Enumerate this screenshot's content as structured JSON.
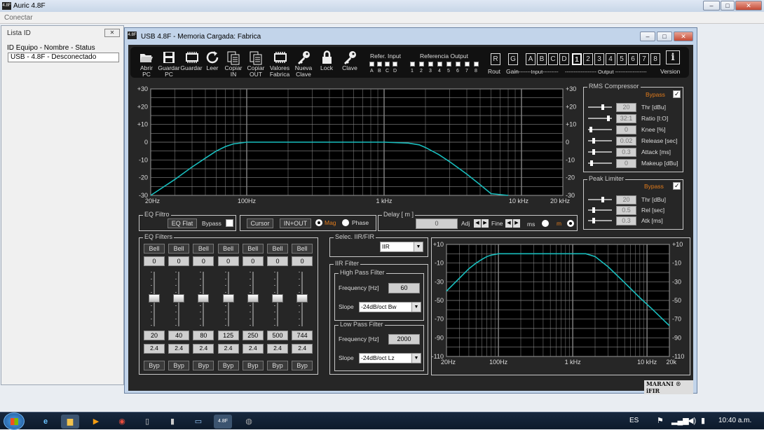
{
  "app": {
    "title": "Auric 4.8F",
    "menu_conectar": "Conectar"
  },
  "lista": {
    "title": "Lista ID",
    "header": "ID Equipo - Nombre - Status",
    "items": [
      "USB - 4.8F - Desconectado"
    ]
  },
  "main_window": {
    "title": "USB  4.8F  -  Memoria Cargada: Fabrica"
  },
  "toolbar": [
    {
      "line1": "Abrir",
      "line2": "PC",
      "icon": "folder-open-icon"
    },
    {
      "line1": "Guardar",
      "line2": "PC",
      "icon": "save-icon"
    },
    {
      "line1": "Guardar",
      "line2": "",
      "icon": "chip-icon"
    },
    {
      "line1": "Leer",
      "line2": "",
      "icon": "refresh-icon"
    },
    {
      "line1": "Copiar",
      "line2": "IN",
      "icon": "copy-icon"
    },
    {
      "line1": "Copiar",
      "line2": "OUT",
      "icon": "copy-icon"
    },
    {
      "line1": "Valores",
      "line2": "Fabrica",
      "icon": "chip-icon"
    },
    {
      "line1": "Nueva",
      "line2": "Clave",
      "icon": "key-icon"
    },
    {
      "line1": "Lock",
      "line2": "",
      "icon": "lock-icon"
    },
    {
      "line1": "Clave",
      "line2": "",
      "icon": "key-icon"
    }
  ],
  "refer_input": {
    "label": "Refer. Input",
    "channels": [
      "A",
      "B",
      "C",
      "D"
    ]
  },
  "ref_output": {
    "label": "Referencia Output",
    "channels": [
      "1",
      "2",
      "3",
      "4",
      "5",
      "6",
      "7",
      "8"
    ]
  },
  "route_gain": {
    "rout_box": "R",
    "rout_label": "Rout",
    "gain_box": "G",
    "gain_label": "Gain"
  },
  "inputs": {
    "labels": [
      "A",
      "B",
      "C",
      "D"
    ],
    "caption": "---------Input---------"
  },
  "outputs": {
    "labels": [
      "1",
      "2",
      "3",
      "4",
      "5",
      "6",
      "7",
      "8"
    ],
    "selected": "1",
    "caption": "------------------ Output ------------------"
  },
  "version": {
    "label": "Version",
    "icon": "i"
  },
  "chart_data": [
    {
      "type": "line",
      "title": "",
      "xlabel": "",
      "ylabel": "",
      "x_scale": "log",
      "x_ticks": [
        "20Hz",
        "100Hz",
        "1 kHz",
        "10 kHz",
        "20 kHz"
      ],
      "x_tick_values": [
        20,
        100,
        1000,
        10000,
        20000
      ],
      "y_ticks": [
        "+30",
        "+20",
        "+10",
        "0",
        "-10",
        "-20",
        "-30"
      ],
      "y_tick_values": [
        30,
        20,
        10,
        0,
        -10,
        -20,
        -30
      ],
      "xlim": [
        20,
        20000
      ],
      "ylim": [
        -30,
        30
      ],
      "grid": true,
      "series": [
        {
          "color": "#19bdbd",
          "x": [
            20,
            30,
            40,
            50,
            60,
            70,
            80,
            100,
            150,
            300,
            1000,
            1500,
            1800,
            2000,
            2500,
            3000,
            4000,
            5000,
            6000,
            8000
          ],
          "values": [
            -30,
            -21,
            -14,
            -9,
            -5,
            -2.5,
            -1,
            0,
            0,
            0,
            0,
            -0.5,
            -1.5,
            -3,
            -7,
            -11,
            -18,
            -24,
            -29,
            -31
          ]
        }
      ]
    },
    {
      "type": "line",
      "title": "",
      "xlabel": "",
      "ylabel": "",
      "x_scale": "log",
      "x_ticks": [
        "20Hz",
        "100Hz",
        "1 kHz",
        "10 kHz",
        "20k"
      ],
      "x_tick_values": [
        20,
        100,
        1000,
        10000,
        20000
      ],
      "y_ticks": [
        "+10",
        "-10",
        "-30",
        "-50",
        "-70",
        "-90",
        "-110"
      ],
      "y_tick_values": [
        10,
        -10,
        -30,
        -50,
        -70,
        -90,
        -110
      ],
      "xlim": [
        20,
        20000
      ],
      "ylim": [
        -110,
        10
      ],
      "grid": true,
      "series": [
        {
          "color": "#19bdbd",
          "x": [
            20,
            30,
            40,
            50,
            60,
            70,
            80,
            100,
            150,
            300,
            1000,
            1500,
            2000,
            3000,
            5000,
            8000,
            12000,
            20000
          ],
          "values": [
            -40,
            -26,
            -16,
            -10,
            -6,
            -3,
            -1.5,
            0,
            0,
            0,
            0,
            0,
            -3,
            -14,
            -31,
            -47,
            -60,
            -77
          ]
        }
      ]
    }
  ],
  "rms": {
    "title": "RMS Compressor",
    "bypass": "Bypass",
    "rows": [
      {
        "value": "20",
        "label": "Thr [dBu]",
        "level": 0.62
      },
      {
        "value": "32:1",
        "label": "Ratio [I:O]",
        "level": 0.9
      },
      {
        "value": "0",
        "label": "Knee [%]",
        "level": 0.08
      },
      {
        "value": "0.02",
        "label": "Release [sec]",
        "level": 0.2
      },
      {
        "value": "0.3",
        "label": "Attack [ms]",
        "level": 0.2
      },
      {
        "value": "0",
        "label": "Makeup [dBu]",
        "level": 0.1
      }
    ]
  },
  "peak": {
    "title": "Peak Limiter",
    "bypass": "Bypass",
    "rows": [
      {
        "value": "20",
        "label": "Thr [dBu]",
        "level": 0.62
      },
      {
        "value": "0.5",
        "label": "Rel [sec]",
        "level": 0.2
      },
      {
        "value": "0.3",
        "label": "Atk [ms]",
        "level": 0.2
      }
    ]
  },
  "eq_filtro": {
    "title": "EQ Filtro",
    "flat": "EQ Flat",
    "bypass": "Bypass"
  },
  "cursor_box": {
    "cursor": "Cursor",
    "inout": "IN+OUT",
    "mag": "Mag",
    "phase": "Phase"
  },
  "delay": {
    "title": "Delay [ m ]",
    "value": "0",
    "adj": "Adj",
    "fine": "Fine",
    "ms": "ms",
    "m": "m"
  },
  "eq_filters": {
    "title": "EQ Filters",
    "bands": [
      {
        "type": "Bell",
        "gain": "0",
        "freq": "20",
        "q": "2.4",
        "byp": "Byp"
      },
      {
        "type": "Bell",
        "gain": "0",
        "freq": "40",
        "q": "2.4",
        "byp": "Byp"
      },
      {
        "type": "Bell",
        "gain": "0",
        "freq": "80",
        "q": "2.4",
        "byp": "Byp"
      },
      {
        "type": "Bell",
        "gain": "0",
        "freq": "125",
        "q": "2.4",
        "byp": "Byp"
      },
      {
        "type": "Bell",
        "gain": "0",
        "freq": "250",
        "q": "2.4",
        "byp": "Byp"
      },
      {
        "type": "Bell",
        "gain": "0",
        "freq": "500",
        "q": "2.4",
        "byp": "Byp"
      },
      {
        "type": "Bell",
        "gain": "0",
        "freq": "744",
        "q": "2.4",
        "byp": "Byp"
      }
    ]
  },
  "iir_select": {
    "title": "Selec. IIR/FIR",
    "value": "IIR"
  },
  "iir_filter": {
    "title": "IIR Filter",
    "hp": {
      "title": "High Pass Filter",
      "freq_label": "Frequency [Hz]",
      "freq": "60",
      "slope_label": "Slope",
      "slope": "-24dB/oct Bw"
    },
    "lp": {
      "title": "Low Pass Filter",
      "freq_label": "Frequency [Hz]",
      "freq": "2000",
      "slope_label": "Slope",
      "slope": "-24dB/oct Lz"
    }
  },
  "brand": "MARANI ® iFIR",
  "taskbar": {
    "lang": "ES",
    "time": "10:40 a.m."
  }
}
